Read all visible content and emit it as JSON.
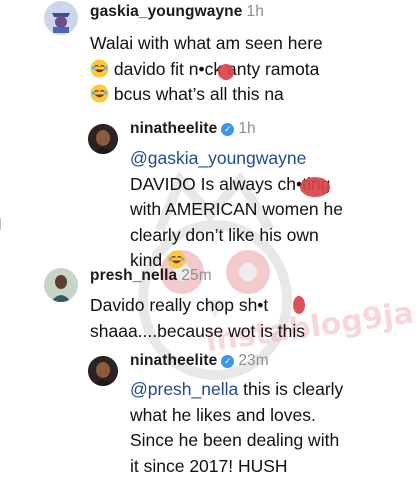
{
  "comments": [
    {
      "username": "gaskia_youngwayne",
      "time": "1h",
      "lines": [
        "Walai with what am seen here",
        "davido fit n•ck anty ramota",
        "bcus what’s all this na"
      ]
    },
    {
      "username": "ninatheelite",
      "verified": true,
      "time": "1h",
      "mention": "@gaskia_youngwayne",
      "lines": [
        "DAVIDO Is always ch•ting",
        "with AMERICAN women he",
        "clearly don’t like his own",
        "kind"
      ]
    },
    {
      "username": "presh_nella",
      "time": "25m",
      "lines": [
        "Davido really chop sh•t",
        "shaaa....because wot is this"
      ]
    },
    {
      "username": "ninatheelite",
      "verified": true,
      "time": "23m",
      "mention": "@presh_nella",
      "lines": [
        "this is clearly",
        "what he likes and loves.",
        "Since he been dealing with",
        "it since 2017! HUSH"
      ]
    }
  ],
  "emoji": "laughing-face",
  "watermark": "instablog9ja",
  "colors": {
    "mention": "#1e4b8f",
    "redact": "#d9434b",
    "verified": "#3897f0",
    "meta": "#8e8e8e"
  }
}
